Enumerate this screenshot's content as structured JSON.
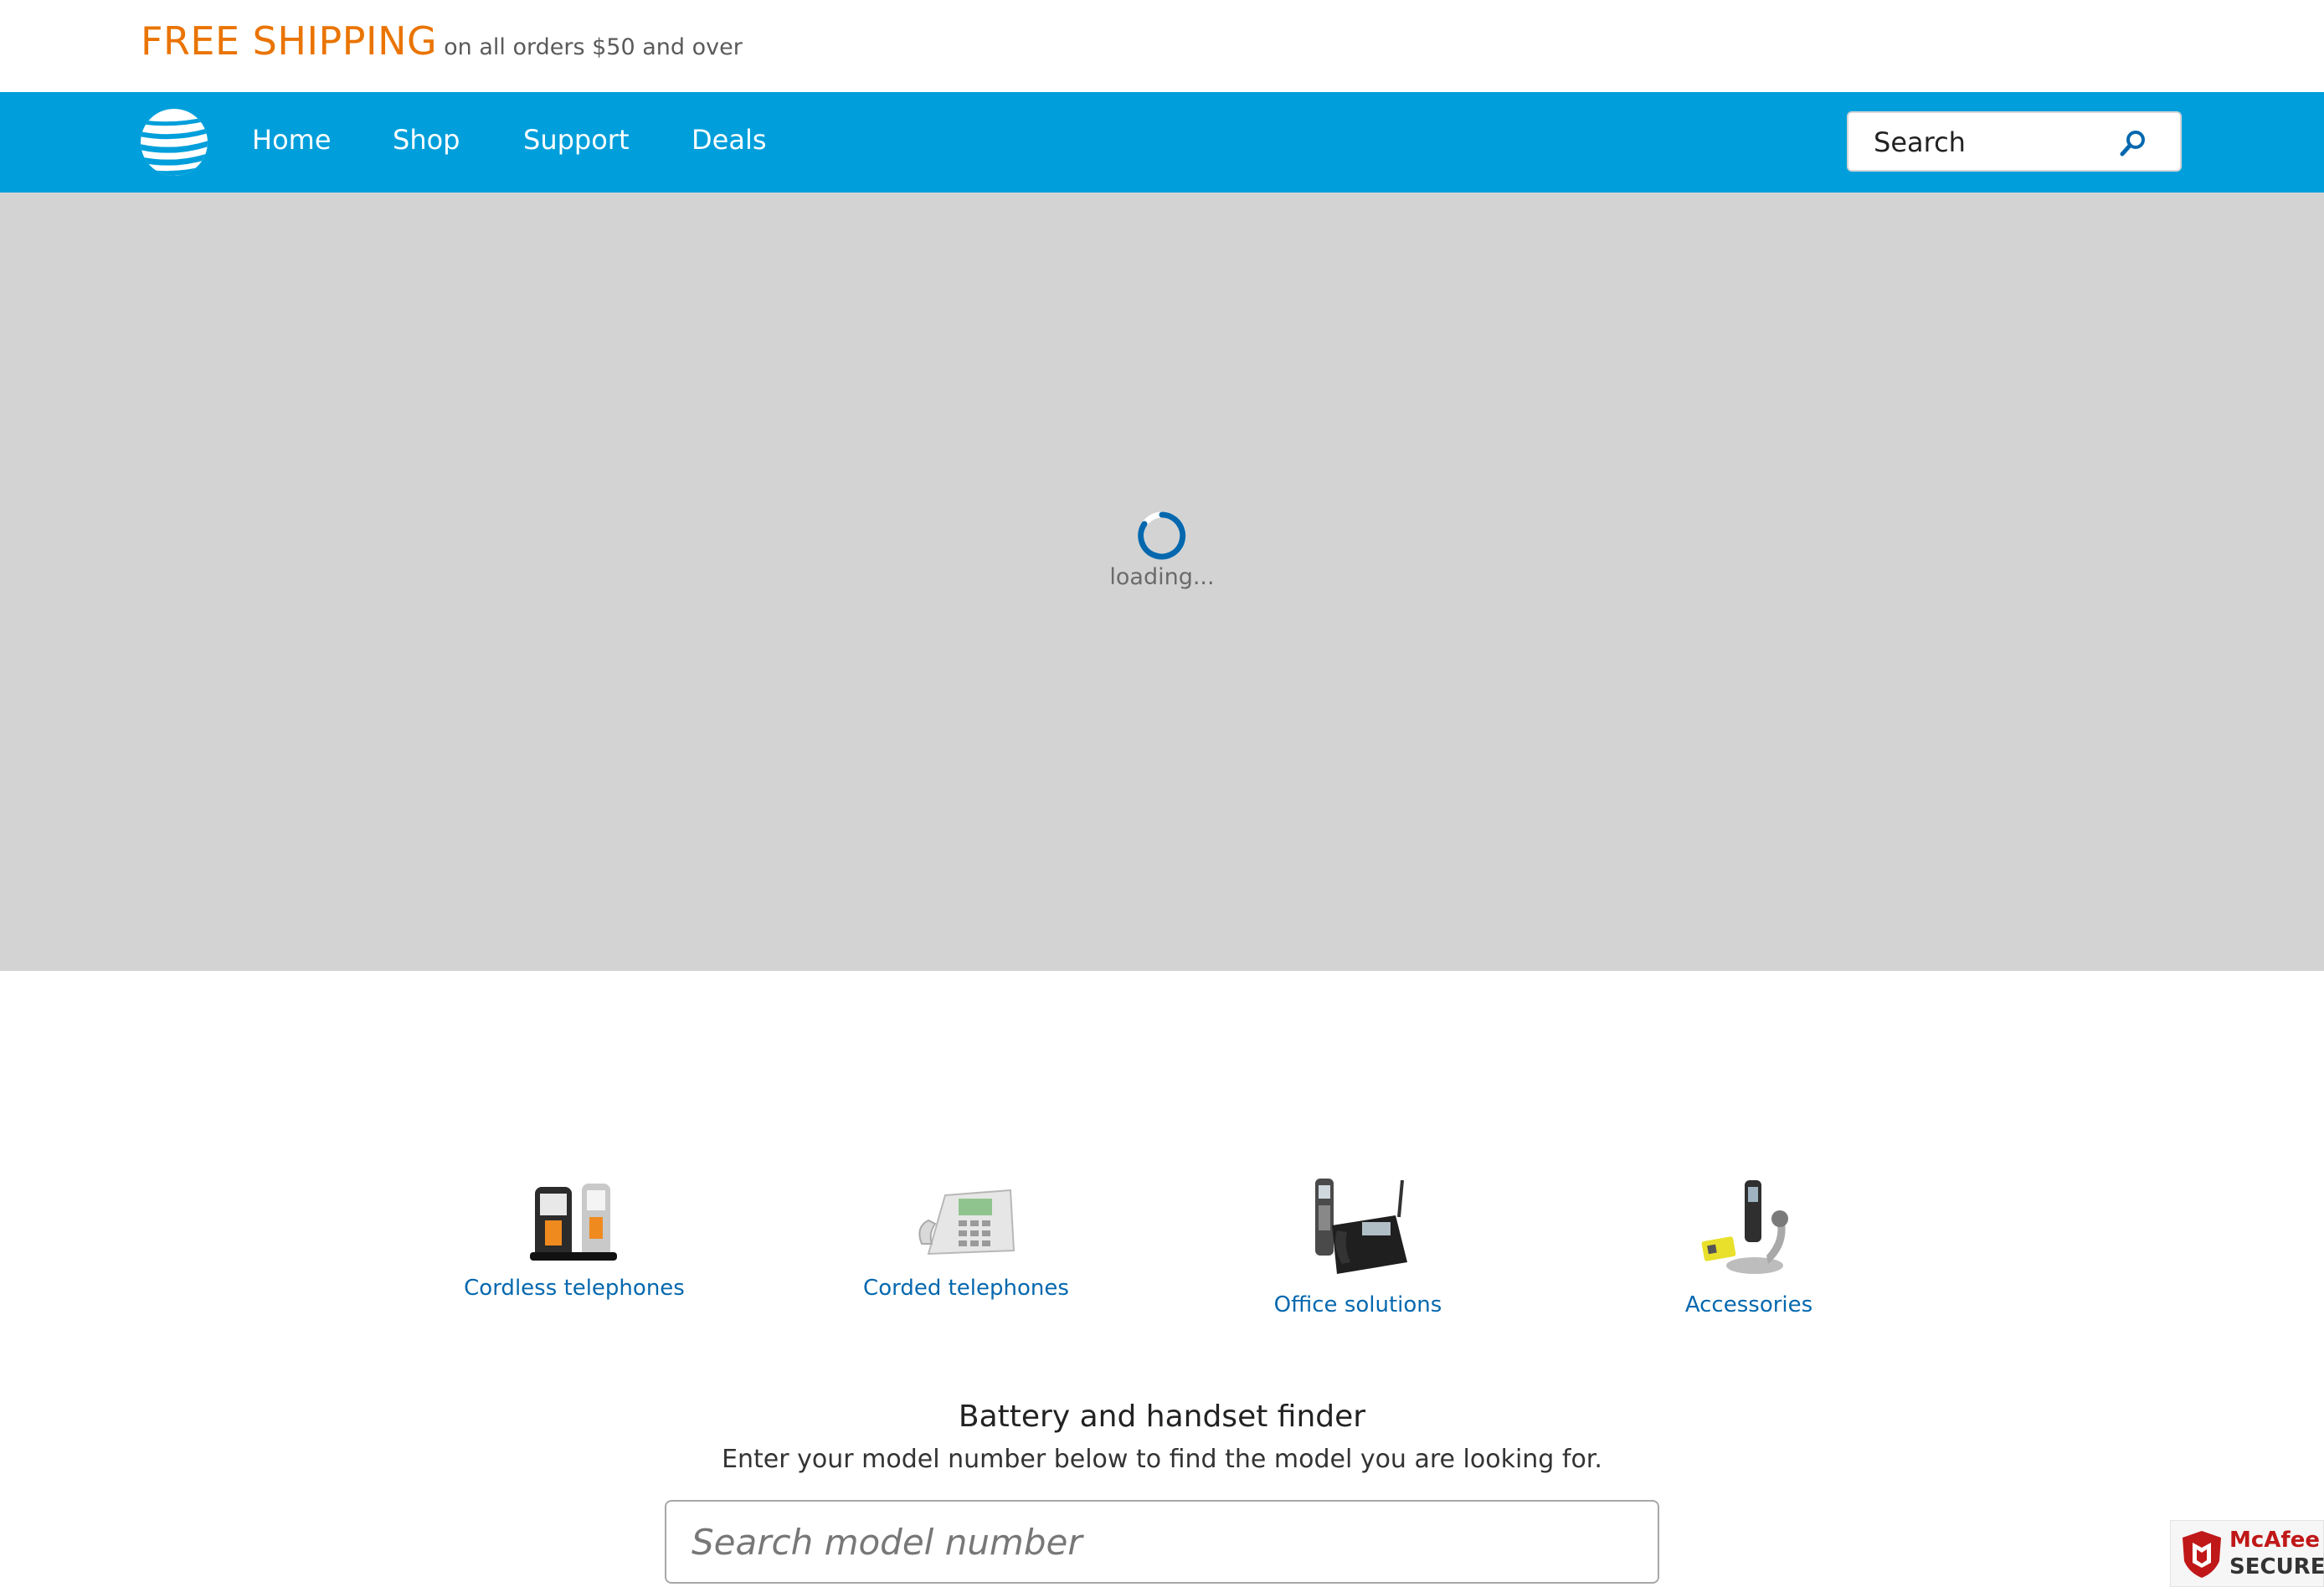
{
  "promo": {
    "headline": "FREE SHIPPING",
    "subtext": "on all orders $50 and over"
  },
  "nav": {
    "items": [
      {
        "label": "Home"
      },
      {
        "label": "Shop"
      },
      {
        "label": "Support"
      },
      {
        "label": "Deals"
      }
    ],
    "search": {
      "placeholder": "Search"
    }
  },
  "hero": {
    "loading_text": "loading..."
  },
  "categories": [
    {
      "label": "Cordless telephones",
      "icon": "cordless-phones-icon"
    },
    {
      "label": "Corded telephones",
      "icon": "corded-phone-icon"
    },
    {
      "label": "Office solutions",
      "icon": "office-phone-icon"
    },
    {
      "label": "Accessories",
      "icon": "headset-accessories-icon"
    }
  ],
  "finder": {
    "title": "Battery and handset finder",
    "subtitle": "Enter your model number below to find the model you are looking for.",
    "placeholder": "Search model number"
  },
  "badge": {
    "name": "McAfee",
    "secure": "SECURE"
  },
  "colors": {
    "brand_blue": "#009fdb",
    "promo_orange": "#ea7400",
    "link_blue": "#0568ae",
    "hero_gray": "#d3d3d3"
  }
}
